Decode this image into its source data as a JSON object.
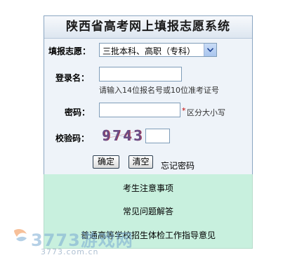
{
  "header": {
    "title": "陕西省高考网上填报志愿系统"
  },
  "form": {
    "batch_label": "填报志愿：",
    "batch_value": "三批本科、高职（专科）",
    "login_label": "登录名：",
    "login_hint": "请输入14位报名号或10位准考证号",
    "password_label": "密码：",
    "password_required": "*",
    "password_hint": "区分大小写",
    "captcha_label": "校验码：",
    "captcha_image_text": "9743",
    "confirm_label": "确定",
    "clear_label": "清空",
    "forgot_label": "忘记密码"
  },
  "notices": [
    {
      "label": "考生注意事项"
    },
    {
      "label": "常见问题解答"
    },
    {
      "label": "普通高等学校招生体检工作指导意见"
    }
  ],
  "watermark": {
    "logo_text": "3773游戏网",
    "url_text": "3773.com.cn"
  },
  "colors": {
    "panel_bg": "#eef3f9",
    "border": "#8aa6c2",
    "notice_bg": "#c8f0de"
  }
}
